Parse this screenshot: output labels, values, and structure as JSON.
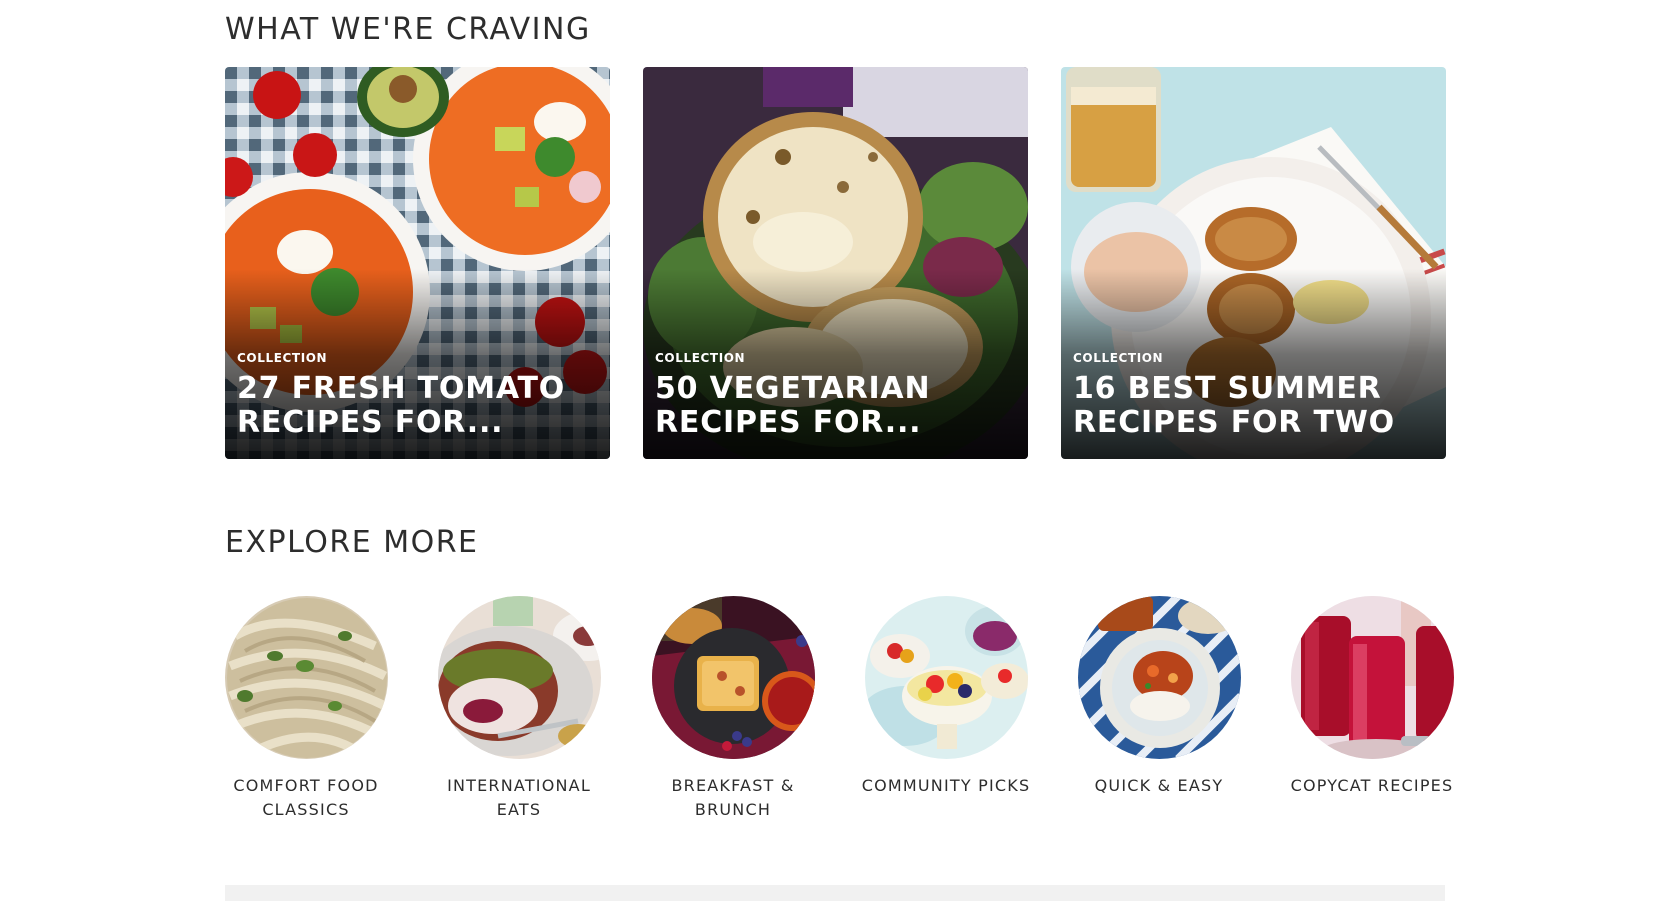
{
  "sections": {
    "craving": {
      "title": "WHAT WE'RE CRAVING"
    },
    "explore": {
      "title": "EXPLORE MORE"
    }
  },
  "cards": [
    {
      "eyebrow": "COLLECTION",
      "title": "27 FRESH TOMATO RECIPES FOR..."
    },
    {
      "eyebrow": "COLLECTION",
      "title": "50 VEGETARIAN RECIPES FOR..."
    },
    {
      "eyebrow": "COLLECTION",
      "title": "16 BEST SUMMER RECIPES FOR TWO"
    }
  ],
  "explore_items": [
    {
      "label": "COMFORT FOOD CLASSICS"
    },
    {
      "label": "INTERNATIONAL EATS"
    },
    {
      "label": "BREAKFAST & BRUNCH"
    },
    {
      "label": "COMMUNITY PICKS"
    },
    {
      "label": "QUICK & EASY"
    },
    {
      "label": "COPYCAT RECIPES"
    }
  ]
}
